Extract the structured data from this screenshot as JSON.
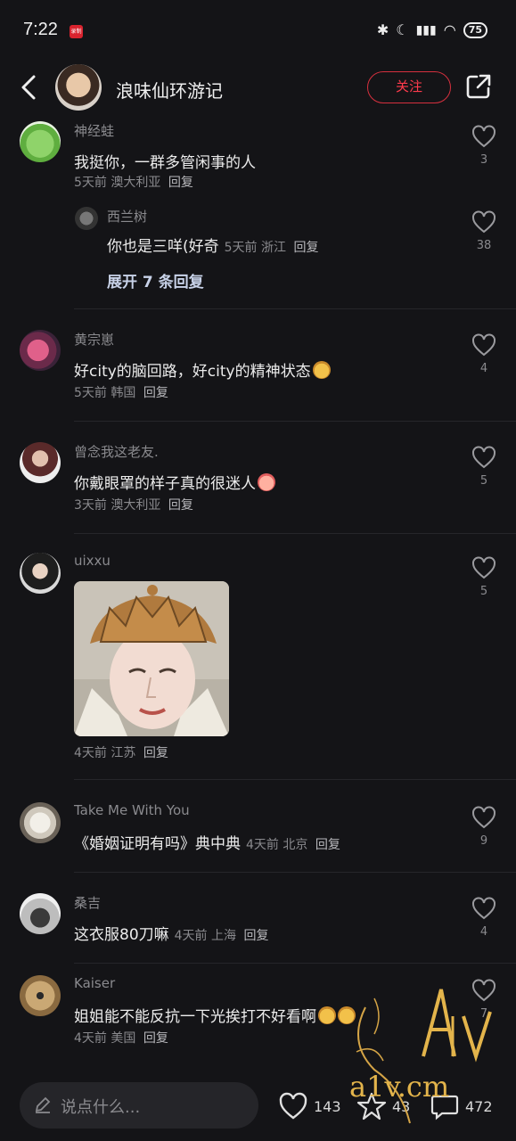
{
  "status_bar": {
    "time": "7:22",
    "rec": "录制",
    "battery": "75"
  },
  "header": {
    "title": "浪味仙环游记",
    "follow_label": "关注"
  },
  "comments": [
    {
      "name": "神经蛙",
      "text": "我挺你，一群多管闲事的人",
      "time": "5天前",
      "region": "澳大利亚",
      "reply": "回复",
      "likes": "3"
    },
    {
      "name": "西兰树",
      "text": "你也是三咩(好奇",
      "time": "5天前",
      "region": "浙江",
      "reply": "回复",
      "likes": "38",
      "expand": "展开 7 条回复"
    },
    {
      "name": "黄宗崽",
      "text": "好city的脑回路，好city的精神状态",
      "time": "5天前",
      "region": "韩国",
      "reply": "回复",
      "likes": "4"
    },
    {
      "name": "曾念我这老友.",
      "text": "你戴眼罩的样子真的很迷人",
      "time": "3天前",
      "region": "澳大利亚",
      "reply": "回复",
      "likes": "5"
    },
    {
      "name": "uixxu",
      "text": "",
      "time": "4天前",
      "region": "江苏",
      "reply": "回复",
      "likes": "5"
    },
    {
      "name": "Take Me With You",
      "text": "《婚姻证明有吗》典中典",
      "time": "4天前",
      "region": "北京",
      "reply": "回复",
      "likes": "9"
    },
    {
      "name": "桑吉",
      "text": "这衣服80刀嘛",
      "time": "4天前",
      "region": "上海",
      "reply": "回复",
      "likes": "4"
    },
    {
      "name": "Kaiser",
      "text": "姐姐能不能反抗一下光挨打不好看啊",
      "time": "4天前",
      "region": "美国",
      "reply": "回复",
      "likes": "7"
    }
  ],
  "bottom_bar": {
    "placeholder": "说点什么...",
    "likes": "143",
    "favorites": "43",
    "comments": "472"
  },
  "watermark": {
    "logo": "A1V",
    "site": "a1v.cm"
  }
}
